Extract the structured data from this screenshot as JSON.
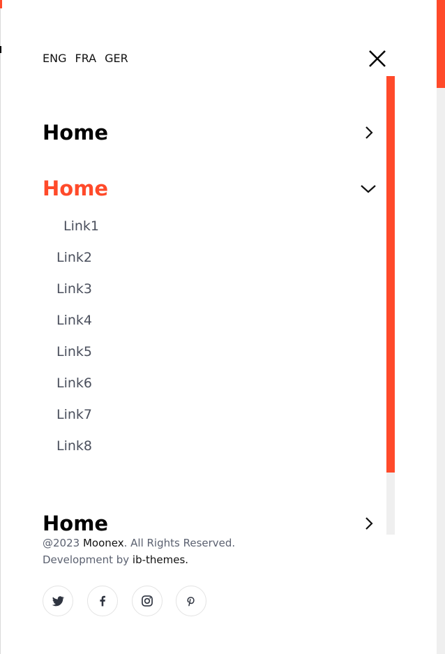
{
  "languages": [
    "ENG",
    "FRA",
    "GER"
  ],
  "menu": {
    "items": [
      {
        "label": "Home",
        "expanded": false
      },
      {
        "label": "Home",
        "expanded": true
      },
      {
        "label": "Home",
        "expanded": false
      }
    ],
    "sublinks": [
      "Link1",
      "Link2",
      "Link3",
      "Link4",
      "Link5",
      "Link6",
      "Link7",
      "Link8"
    ]
  },
  "footer": {
    "copyright_prefix": "@2023 ",
    "brand": "Moonex",
    "copyright_suffix": ". All Rights Reserved.",
    "dev_prefix": "Development by ",
    "dev_name": "ib-themes."
  },
  "social": [
    {
      "icon": "twitter-icon"
    },
    {
      "icon": "facebook-icon"
    },
    {
      "icon": "instagram-icon"
    },
    {
      "icon": "pinterest-icon"
    }
  ],
  "colors": {
    "accent": "#ff4a2a",
    "text": "#000000",
    "muted": "#5b6170",
    "track": "#efefef"
  }
}
